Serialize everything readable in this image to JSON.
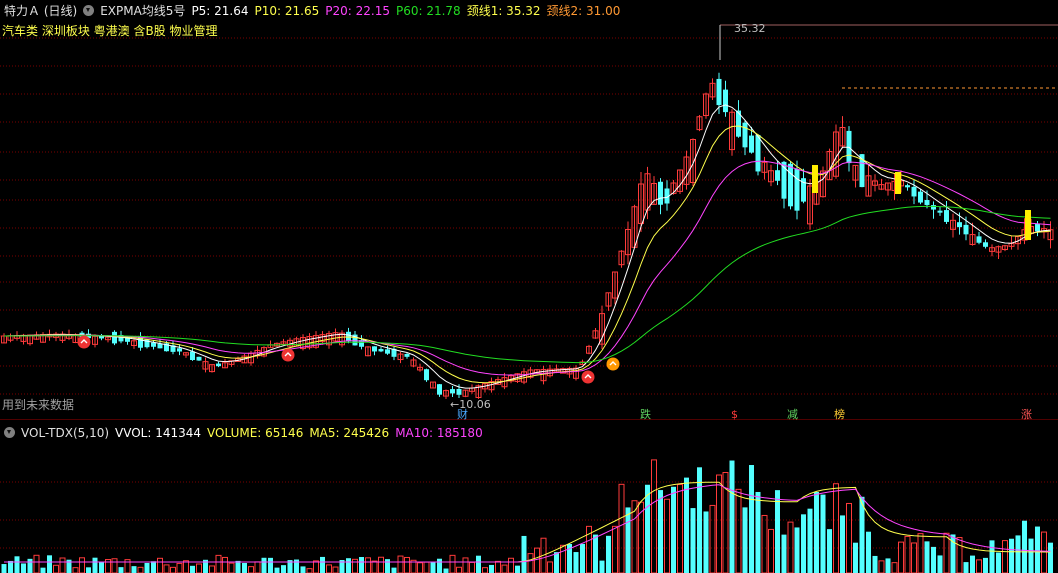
{
  "header": {
    "stock": "特力Ａ (日线)",
    "indicator": "EXPMA均线5号",
    "p5": "P5: 21.64",
    "p10": "P10: 21.65",
    "p20": "P20: 22.15",
    "p60": "P60: 21.78",
    "neck1": "颈线1: 35.32",
    "neck2": "颈线2: 31.00"
  },
  "concepts": "汽车类 深圳板块 粤港澳 含B股 物业管理",
  "future_note": "用到未来数据",
  "price_labels": {
    "high": "35.32",
    "low": "←10.06"
  },
  "event_tags": [
    {
      "text": "财",
      "color": "#4aa8ff"
    },
    {
      "text": "跌",
      "color": "#5fd35f"
    },
    {
      "text": "$",
      "color": "#ff3b3b"
    },
    {
      "text": "减",
      "color": "#5fd35f"
    },
    {
      "text": "榜",
      "color": "#ffcc33"
    },
    {
      "text": "涨",
      "color": "#ff5555"
    }
  ],
  "volume_header": {
    "name": "VOL-TDX(5,10)",
    "vvol": "VVOL: 141344",
    "volume": "VOLUME: 65146",
    "ma5": "MA5: 245426",
    "ma10": "MA10: 185180"
  },
  "colors": {
    "up": "#ff3b3b",
    "down": "#54ffff",
    "p5": "#ffffff",
    "p10": "#ffff4d",
    "p20": "#ff44ff",
    "p60": "#22dd22",
    "neck2": "#ff9933",
    "grid": "#7a0000"
  },
  "chart_data": {
    "type": "candlestick",
    "price_scale": {
      "high": 35.32,
      "low": 10.06
    },
    "high_marker": 35.32,
    "low_marker": 10.06,
    "neckline_1": 35.32,
    "neckline_2": 31.0,
    "last_values": {
      "P5": 21.64,
      "P10": 21.65,
      "P20": 22.15,
      "P60": 21.78
    },
    "volume_last": {
      "VVOL": 141344,
      "VOLUME": 65146,
      "MA5": 245426,
      "MA10": 185180
    }
  }
}
